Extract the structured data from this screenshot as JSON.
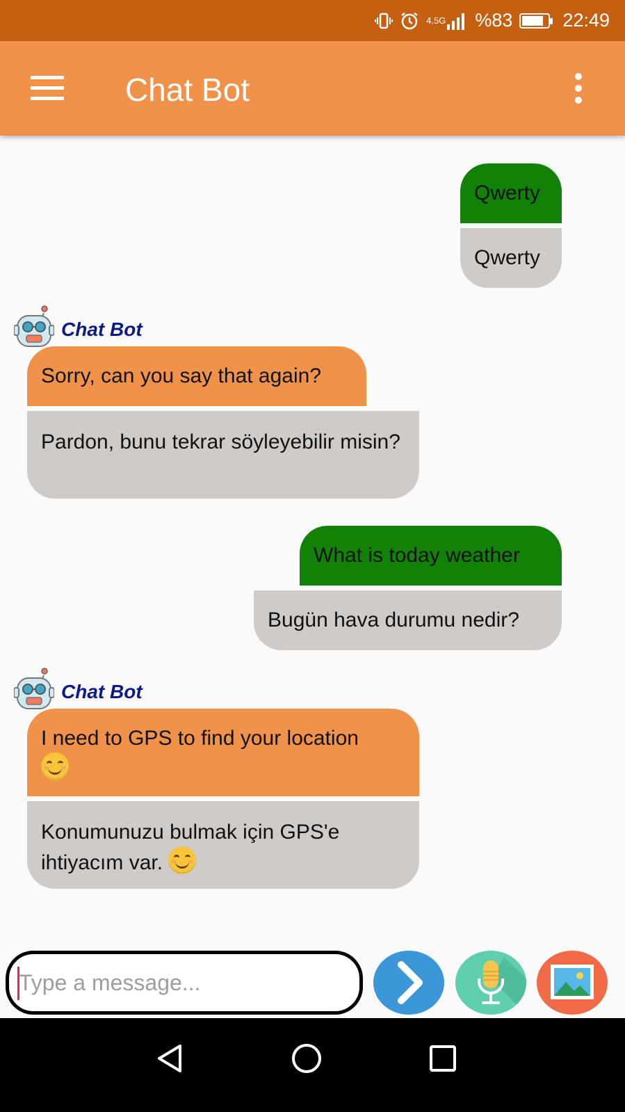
{
  "status_bar": {
    "network": "4.5G",
    "battery": "%83",
    "battery_level": 0.83,
    "time": "22:49"
  },
  "app_bar": {
    "title": "Chat Bot"
  },
  "messages": [
    {
      "sender": "user",
      "text": "Qwerty",
      "translation": "Qwerty"
    },
    {
      "sender": "bot",
      "name": "Chat Bot",
      "text": "Sorry, can you say that again?",
      "translation": "Pardon, bunu tekrar söyleyebilir misin?"
    },
    {
      "sender": "user",
      "text": "What is today weather",
      "translation": "Bugün hava durumu nedir?"
    },
    {
      "sender": "bot",
      "name": "Chat Bot",
      "text": "I need to GPS to find your location",
      "translation": "Konumunuzu bulmak için GPS'e ihtiyacım var."
    }
  ],
  "composer": {
    "placeholder": "Type a message...",
    "value": ""
  },
  "icons": [
    "menu-icon",
    "more-vert-icon",
    "robot-avatar-icon",
    "smile-emoji-icon",
    "send-icon",
    "microphone-icon",
    "image-icon",
    "back-icon",
    "home-icon",
    "recents-icon"
  ],
  "colors": {
    "status_bar": "#c55f12",
    "app_bar": "#f0924a",
    "user_bubble": "#128107",
    "bot_bubble": "#f0924a",
    "translation_bubble": "#cfcbc9",
    "bot_name": "#0b1a86"
  }
}
